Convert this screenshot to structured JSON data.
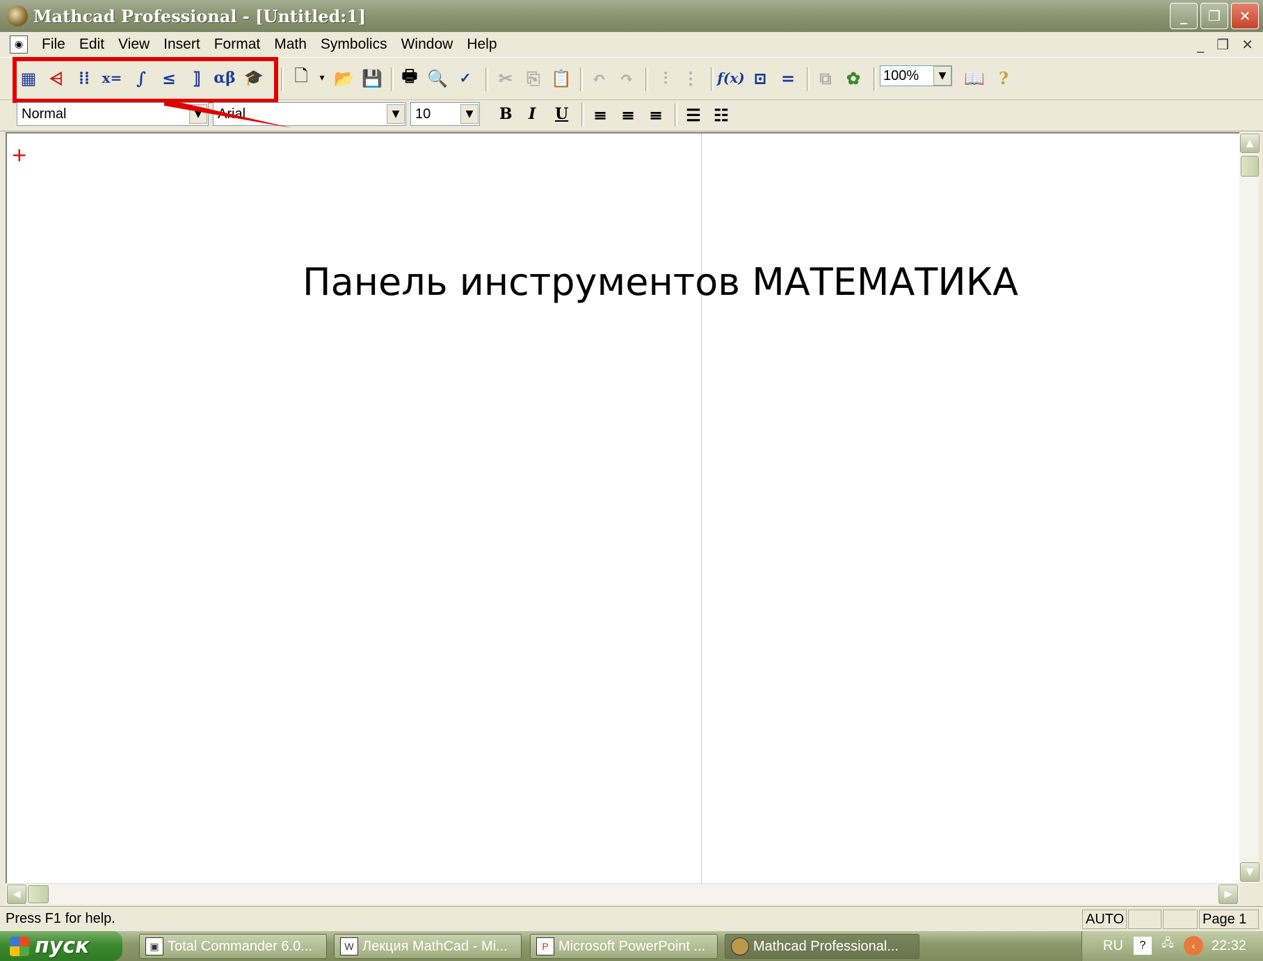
{
  "window": {
    "title": "Mathcad Professional - [Untitled:1]",
    "controls": [
      "_",
      "❐",
      "✕"
    ]
  },
  "menu": {
    "items": [
      "File",
      "Edit",
      "View",
      "Insert",
      "Format",
      "Math",
      "Symbolics",
      "Window",
      "Help"
    ],
    "mdi_controls": [
      "_",
      "❐",
      "✕"
    ]
  },
  "math_toolbar": {
    "icons": [
      "calculator-icon",
      "graph-icon",
      "matrix-icon",
      "evaluation-icon",
      "calculus-icon",
      "boolean-icon",
      "programming-icon",
      "greek-icon",
      "symbolic-icon"
    ],
    "glyphs": [
      "▦",
      "⩤",
      "⁞⁞",
      "x=",
      "∫",
      "≤",
      "⟧",
      "αβ",
      "🎓"
    ]
  },
  "standard_toolbar": {
    "zoom_value": "100%"
  },
  "format_toolbar": {
    "style_value": "Normal",
    "font_value": "Arial",
    "size_value": "10",
    "bold": "B",
    "italic": "I",
    "underline": "U"
  },
  "document": {
    "cursor": "+",
    "caption": "Панель инструментов МАТЕМАТИКА"
  },
  "status": {
    "help": "Press F1 for help.",
    "mode": "AUTO",
    "page": "Page 1"
  },
  "taskbar": {
    "start": "пуск",
    "tasks": [
      "Total Commander 6.0...",
      "Лекция MathCad - Mi...",
      "Microsoft PowerPoint ...",
      "Mathcad Professional..."
    ],
    "lang": "RU",
    "time": "22:32"
  },
  "colors": {
    "highlight_red": "#e00000",
    "titlebar": "#8d9572"
  }
}
